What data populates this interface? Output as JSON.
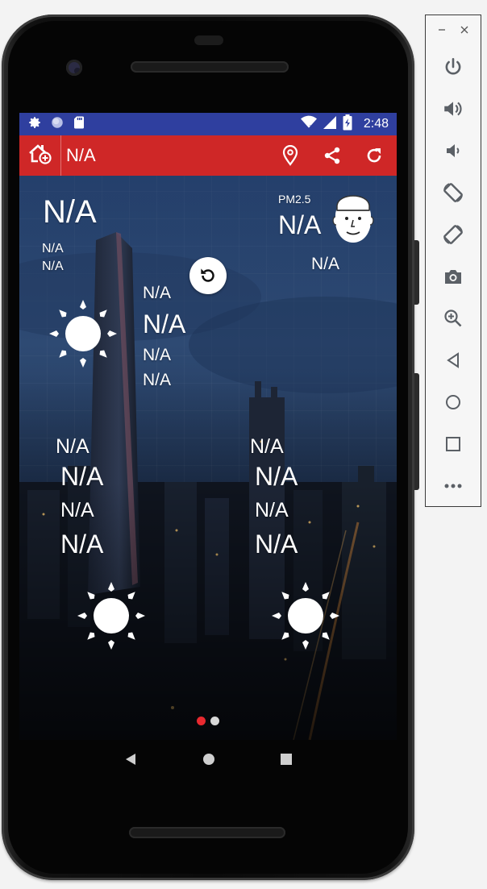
{
  "status_bar": {
    "time": "2:48",
    "icons": [
      "gear-icon",
      "circle-icon",
      "sdcard-icon",
      "wifi-icon",
      "signal-icon",
      "battery-charging-icon"
    ]
  },
  "app_bar": {
    "title": "N/A",
    "icons": [
      "home-add-icon",
      "location-pin-icon",
      "share-icon",
      "refresh-icon"
    ],
    "color": "#cf2727"
  },
  "current": {
    "temperature": "N/A",
    "line1": "N/A",
    "line2": "N/A",
    "detail1": "N/A",
    "detail_big": "N/A",
    "detail2": "N/A",
    "detail3": "N/A",
    "weather_icon": "sun-icon"
  },
  "air": {
    "label": "PM2.5",
    "value": "N/A",
    "quality": "N/A",
    "icon": "face-mask-icon"
  },
  "forecast": [
    {
      "line1": "N/A",
      "line2": "N/A",
      "line3": "N/A",
      "line4": "N/A",
      "icon": "sun-icon"
    },
    {
      "line1": "N/A",
      "line2": "N/A",
      "line3": "N/A",
      "line4": "N/A",
      "icon": "sun-icon"
    }
  ],
  "pager": {
    "count": 2,
    "active": 0,
    "active_color": "#e8292f",
    "inactive_color": "#d8d8d8"
  },
  "nav_bar": {
    "icons": [
      "back-icon",
      "home-icon",
      "recents-icon"
    ]
  },
  "emulator_toolbar": {
    "window_icons": [
      "minimize-icon",
      "close-icon"
    ],
    "buttons": [
      "power-icon",
      "volume-up-icon",
      "volume-down-icon",
      "rotate-left-icon",
      "rotate-right-icon",
      "camera-icon",
      "zoom-icon",
      "back-icon",
      "home-icon",
      "overview-icon",
      "more-icon"
    ]
  }
}
